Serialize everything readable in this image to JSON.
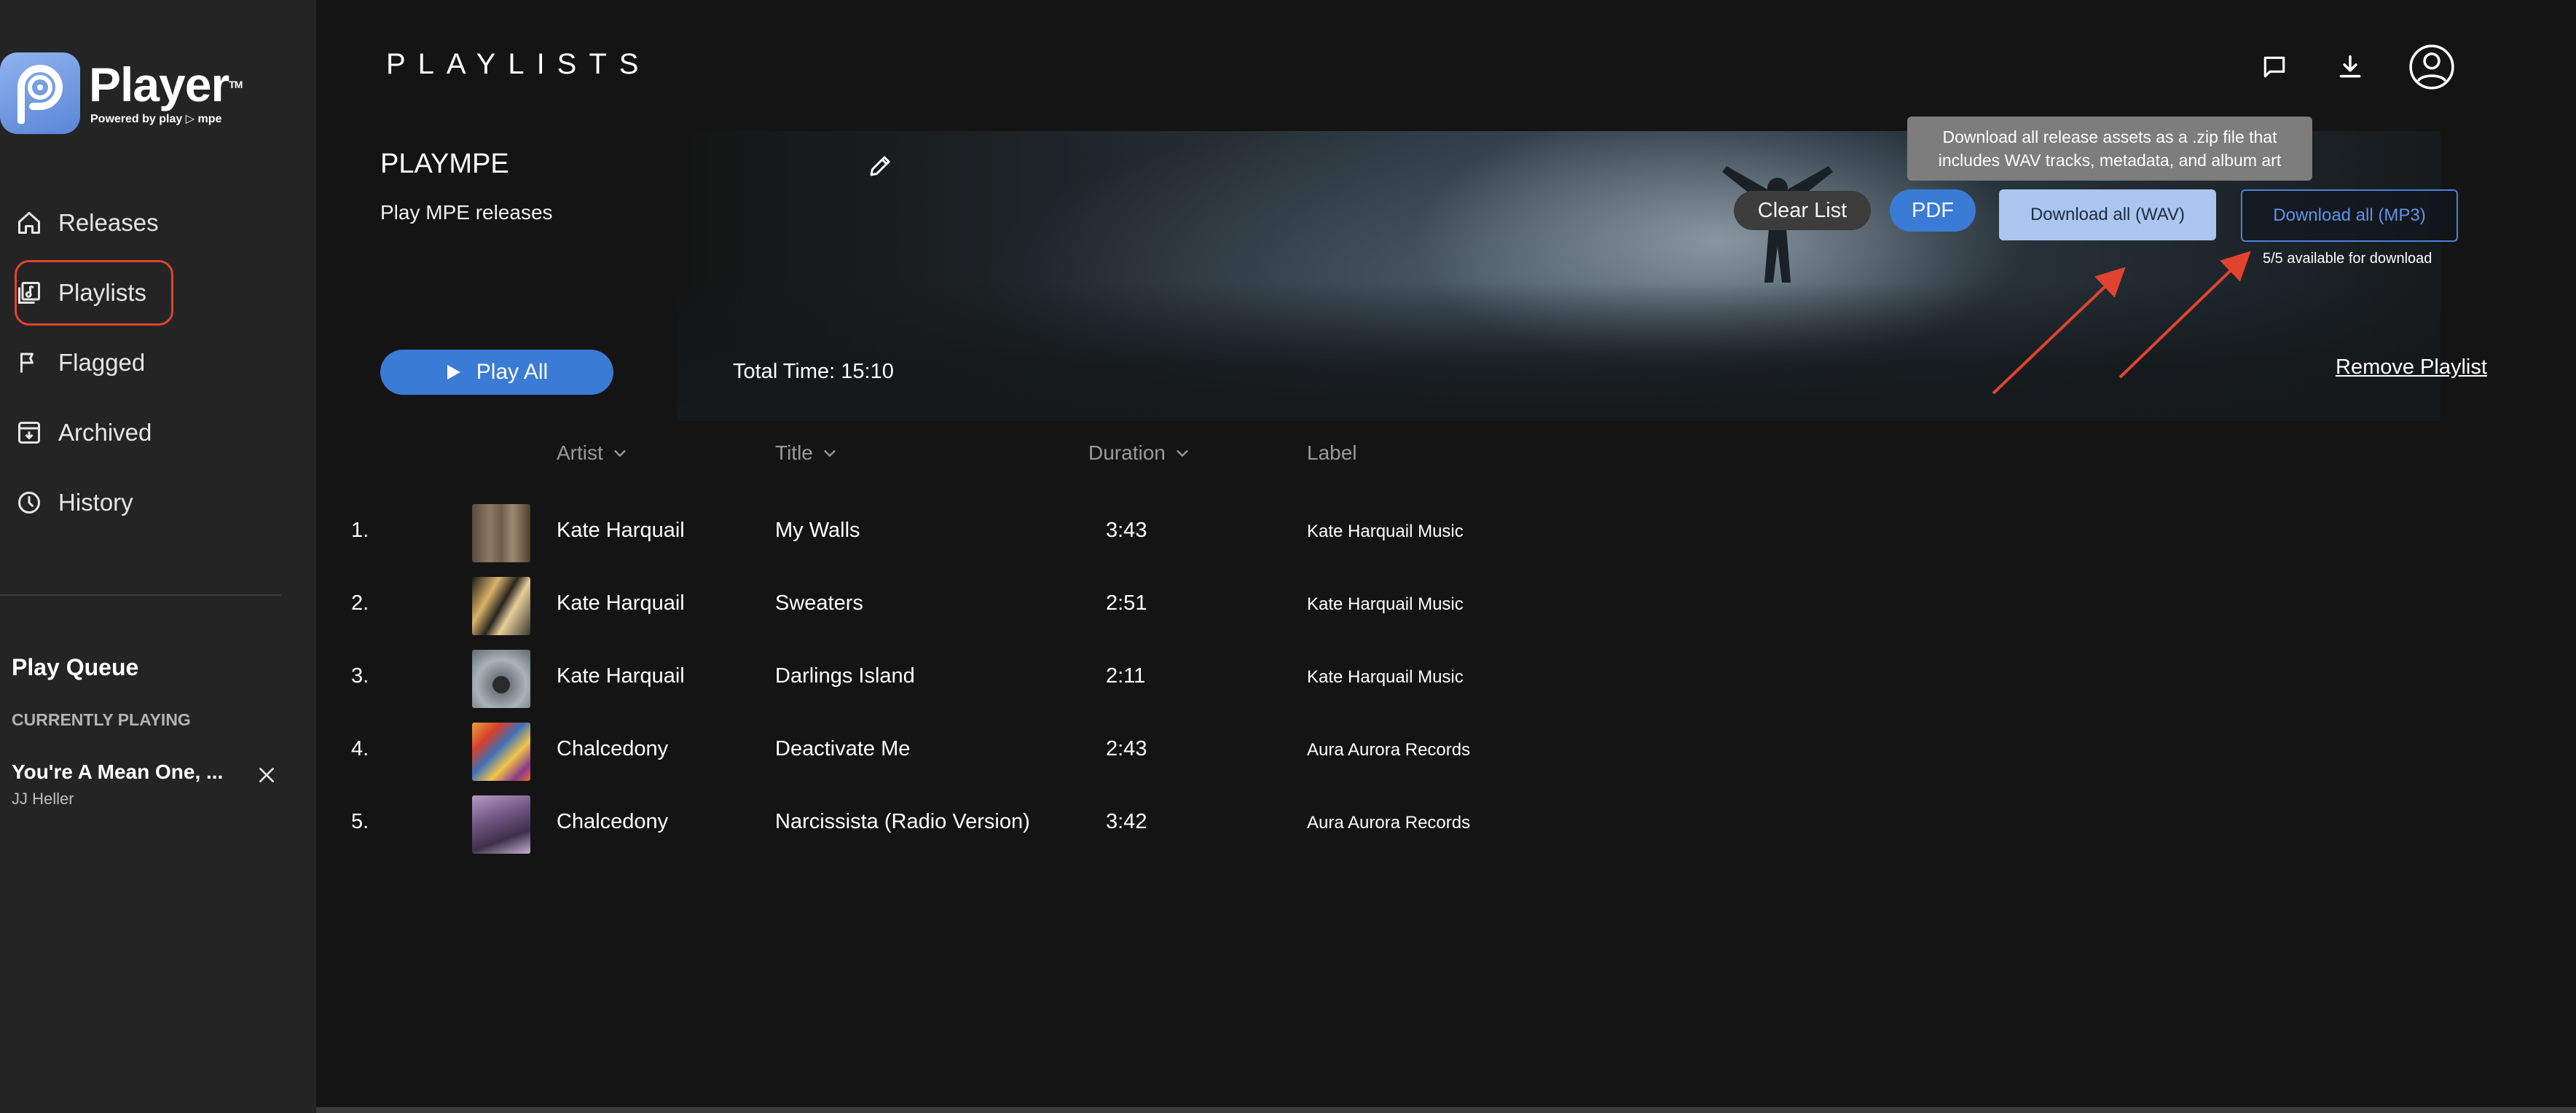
{
  "brand": {
    "title": "Player",
    "tm": "TM",
    "subtitle": "Powered by play ▷ mpe",
    "badge_color": "#6f98e2"
  },
  "nav": {
    "items": [
      {
        "label": "Releases",
        "icon": "home-icon"
      },
      {
        "label": "Playlists",
        "icon": "playlist-icon",
        "active": true
      },
      {
        "label": "Flagged",
        "icon": "flag-icon"
      },
      {
        "label": "Archived",
        "icon": "archive-icon"
      },
      {
        "label": "History",
        "icon": "clock-icon"
      }
    ]
  },
  "queue": {
    "title": "Play Queue",
    "section": "CURRENTLY PLAYING",
    "current": {
      "song": "You're A Mean One, ...",
      "artist": "JJ Heller"
    }
  },
  "header": {
    "title": "PLAYLISTS",
    "icons": [
      "chat-icon",
      "download-icon",
      "account-icon"
    ]
  },
  "playlist": {
    "name": "PLAYMPE",
    "description": "Play MPE releases",
    "total_time": "Total Time: 15:10"
  },
  "actions": {
    "clear": "Clear List",
    "pdf": "PDF",
    "download_wav": "Download all (WAV)",
    "download_mp3": "Download all (MP3)",
    "availability": "5/5 available for download",
    "tooltip_line1": "Download all release assets as a .zip file that",
    "tooltip_line2": "includes WAV tracks, metadata, and album art",
    "play_all": "Play All",
    "remove": "Remove Playlist"
  },
  "table": {
    "headers": {
      "artist": "Artist",
      "title": "Title",
      "duration": "Duration",
      "label": "Label"
    },
    "rows": [
      {
        "num": "1.",
        "artist": "Kate Harquail",
        "title": "My Walls",
        "duration": "3:43",
        "label": "Kate Harquail Music"
      },
      {
        "num": "2.",
        "artist": "Kate Harquail",
        "title": "Sweaters",
        "duration": "2:51",
        "label": "Kate Harquail Music"
      },
      {
        "num": "3.",
        "artist": "Kate Harquail",
        "title": "Darlings Island",
        "duration": "2:11",
        "label": "Kate Harquail Music"
      },
      {
        "num": "4.",
        "artist": "Chalcedony",
        "title": "Deactivate Me",
        "duration": "2:43",
        "label": "Aura Aurora Records"
      },
      {
        "num": "5.",
        "artist": "Chalcedony",
        "title": "Narcissista (Radio Version)",
        "duration": "3:42",
        "label": "Aura Aurora Records"
      }
    ]
  },
  "colors": {
    "accent": "#3a7bd5",
    "annotation": "#e0442f",
    "sidebar": "#242424",
    "background": "#141414"
  }
}
